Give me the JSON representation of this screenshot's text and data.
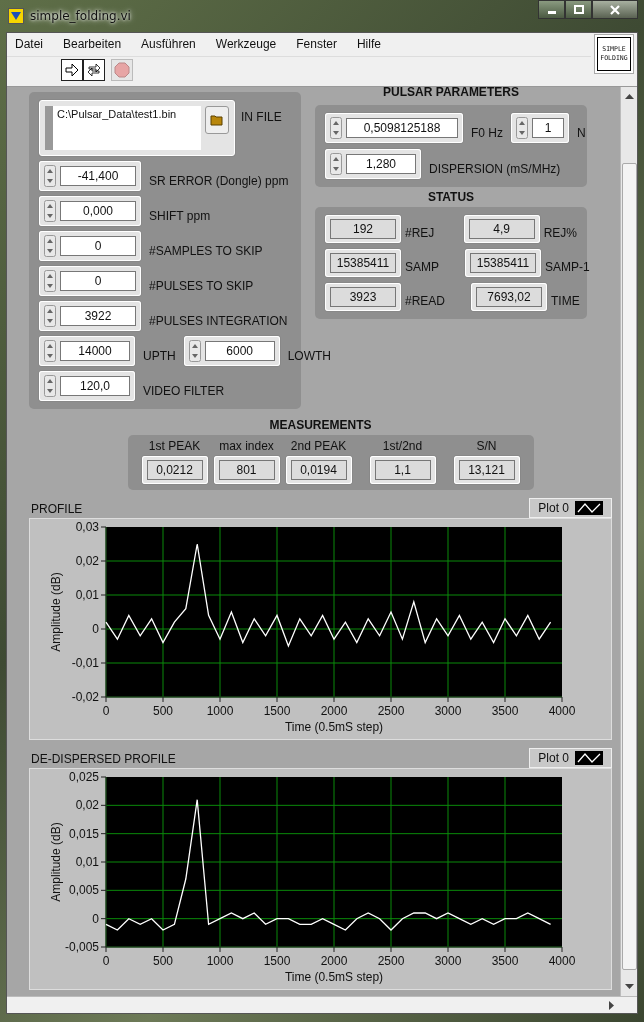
{
  "window": {
    "title": "simple_folding.vi"
  },
  "menu": [
    "Datei",
    "Bearbeiten",
    "Ausführen",
    "Werkzeuge",
    "Fenster",
    "Hilfe"
  ],
  "vi_icon": {
    "lines": [
      "SIMPLE",
      "FOLDING"
    ]
  },
  "input_panel": {
    "file": {
      "value": "C:\\Pulsar_Data\\test1.bin",
      "label": "IN FILE"
    },
    "rows": [
      [
        {
          "value": "-41,400",
          "label": "SR ERROR (Dongle) ppm",
          "wide": true
        }
      ],
      [
        {
          "value": "0,000",
          "label": "SHIFT ppm",
          "wide": true
        }
      ],
      [
        {
          "value": "0",
          "label": "#SAMPLES TO SKIP",
          "wide": true
        }
      ],
      [
        {
          "value": "0",
          "label": "#PULSES TO SKIP",
          "wide": true
        }
      ],
      [
        {
          "value": "3922",
          "label": "#PULSES INTEGRATION",
          "wide": true
        }
      ],
      [
        {
          "value": "14000",
          "label": "UPTH",
          "wide": false
        },
        {
          "value": "6000",
          "label": "LOWTH",
          "wide": false
        }
      ],
      [
        {
          "value": "120,0",
          "label": "VIDEO FILTER",
          "wide": false
        }
      ]
    ]
  },
  "pulsar_parameters": {
    "title": "PULSAR PARAMETERS",
    "rows": [
      [
        {
          "value": "0,5098125188",
          "label": "F0 Hz",
          "wide": true
        },
        {
          "value": "1",
          "label": "N",
          "wide": false
        }
      ],
      [
        {
          "value": "1,280",
          "label": "DISPERSION (mS/MHz)",
          "wide": false
        }
      ]
    ]
  },
  "status": {
    "title": "STATUS",
    "rows": [
      [
        {
          "value": "192",
          "label": "#REJ"
        },
        {
          "value": "4,9",
          "label": "REJ%"
        }
      ],
      [
        {
          "value": "15385411",
          "label": "SAMP"
        },
        {
          "value": "15385411",
          "label": "SAMP-1"
        }
      ],
      [
        {
          "value": "3923",
          "label": "#READ"
        },
        {
          "value": "7693,02",
          "label": "TIME"
        }
      ]
    ]
  },
  "measurements": {
    "title": "MEASUREMENTS",
    "items": [
      {
        "label": "1st PEAK",
        "value": "0,0212"
      },
      {
        "label": "max index",
        "value": "801"
      },
      {
        "label": "2nd PEAK",
        "value": "0,0194"
      },
      {
        "label": "1st/2nd",
        "value": "1,1"
      },
      {
        "label": "S/N",
        "value": "13,121"
      }
    ]
  },
  "charts": [
    {
      "title": "PROFILE",
      "chart_data": {
        "type": "line",
        "grid": true,
        "xlabel": "Time (0.5mS step)",
        "ylabel": "Amplitude (dB)",
        "x": [
          0,
          100,
          200,
          300,
          400,
          500,
          600,
          700,
          800,
          900,
          1000,
          1100,
          1200,
          1300,
          1400,
          1500,
          1600,
          1700,
          1800,
          1900,
          2000,
          2100,
          2200,
          2300,
          2400,
          2500,
          2600,
          2700,
          2800,
          2900,
          3000,
          3100,
          3200,
          3300,
          3400,
          3500,
          3600,
          3700,
          3800,
          3900
        ],
        "series": [
          {
            "name": "Plot 0",
            "color": "#ffffff",
            "values": [
              0.002,
              -0.003,
              0.004,
              -0.002,
              0.003,
              -0.004,
              0.002,
              0.006,
              0.025,
              0.004,
              -0.003,
              0.005,
              -0.004,
              0.003,
              -0.002,
              0.004,
              -0.005,
              0.003,
              -0.002,
              0.004,
              -0.003,
              0.002,
              -0.004,
              0.003,
              -0.002,
              0.005,
              -0.003,
              0.008,
              -0.004,
              0.003,
              -0.002,
              0.004,
              -0.003,
              0.002,
              -0.004,
              0.003,
              -0.002,
              0.004,
              -0.003,
              0.002
            ]
          }
        ],
        "xlim": [
          0,
          4000
        ],
        "ylim": [
          -0.02,
          0.03
        ],
        "xticks": [
          0,
          500,
          1000,
          1500,
          2000,
          2500,
          3000,
          3500,
          4000
        ],
        "yticks": [
          {
            "value": -0.02,
            "label": "-0,02"
          },
          {
            "value": -0.01,
            "label": "-0,01"
          },
          {
            "value": 0,
            "label": "0"
          },
          {
            "value": 0.01,
            "label": "0,01"
          },
          {
            "value": 0.02,
            "label": "0,02"
          },
          {
            "value": 0.03,
            "label": "0,03"
          }
        ]
      }
    },
    {
      "title": "DE-DISPERSED PROFILE",
      "chart_data": {
        "type": "line",
        "grid": true,
        "xlabel": "Time (0.5mS step)",
        "ylabel": "Amplitude (dB)",
        "x": [
          0,
          100,
          200,
          300,
          400,
          500,
          600,
          700,
          800,
          900,
          1000,
          1100,
          1200,
          1300,
          1400,
          1500,
          1600,
          1700,
          1800,
          1900,
          2000,
          2100,
          2200,
          2300,
          2400,
          2500,
          2600,
          2700,
          2800,
          2900,
          3000,
          3100,
          3200,
          3300,
          3400,
          3500,
          3600,
          3700,
          3800,
          3900
        ],
        "series": [
          {
            "name": "Plot 0",
            "color": "#ffffff",
            "values": [
              -0.001,
              -0.002,
              0.0,
              -0.001,
              0.0,
              -0.002,
              -0.001,
              0.007,
              0.021,
              -0.001,
              0.0,
              0.001,
              0.0,
              0.001,
              -0.001,
              0.0,
              0.0,
              -0.001,
              -0.001,
              0.0,
              -0.001,
              -0.002,
              0.0,
              0.001,
              0.0,
              -0.002,
              0.0,
              0.001,
              0.001,
              0.0,
              0.001,
              0.0,
              -0.001,
              0.0,
              -0.001,
              0.0,
              0.0,
              0.001,
              0.0,
              -0.001
            ]
          }
        ],
        "xlim": [
          0,
          4000
        ],
        "ylim": [
          -0.005,
          0.025
        ],
        "xticks": [
          0,
          500,
          1000,
          1500,
          2000,
          2500,
          3000,
          3500,
          4000
        ],
        "yticks": [
          {
            "value": -0.005,
            "label": "-0,005"
          },
          {
            "value": 0,
            "label": "0"
          },
          {
            "value": 0.005,
            "label": "0,005"
          },
          {
            "value": 0.01,
            "label": "0,01"
          },
          {
            "value": 0.015,
            "label": "0,015"
          },
          {
            "value": 0.02,
            "label": "0,02"
          },
          {
            "value": 0.025,
            "label": "0,025"
          }
        ]
      }
    }
  ]
}
